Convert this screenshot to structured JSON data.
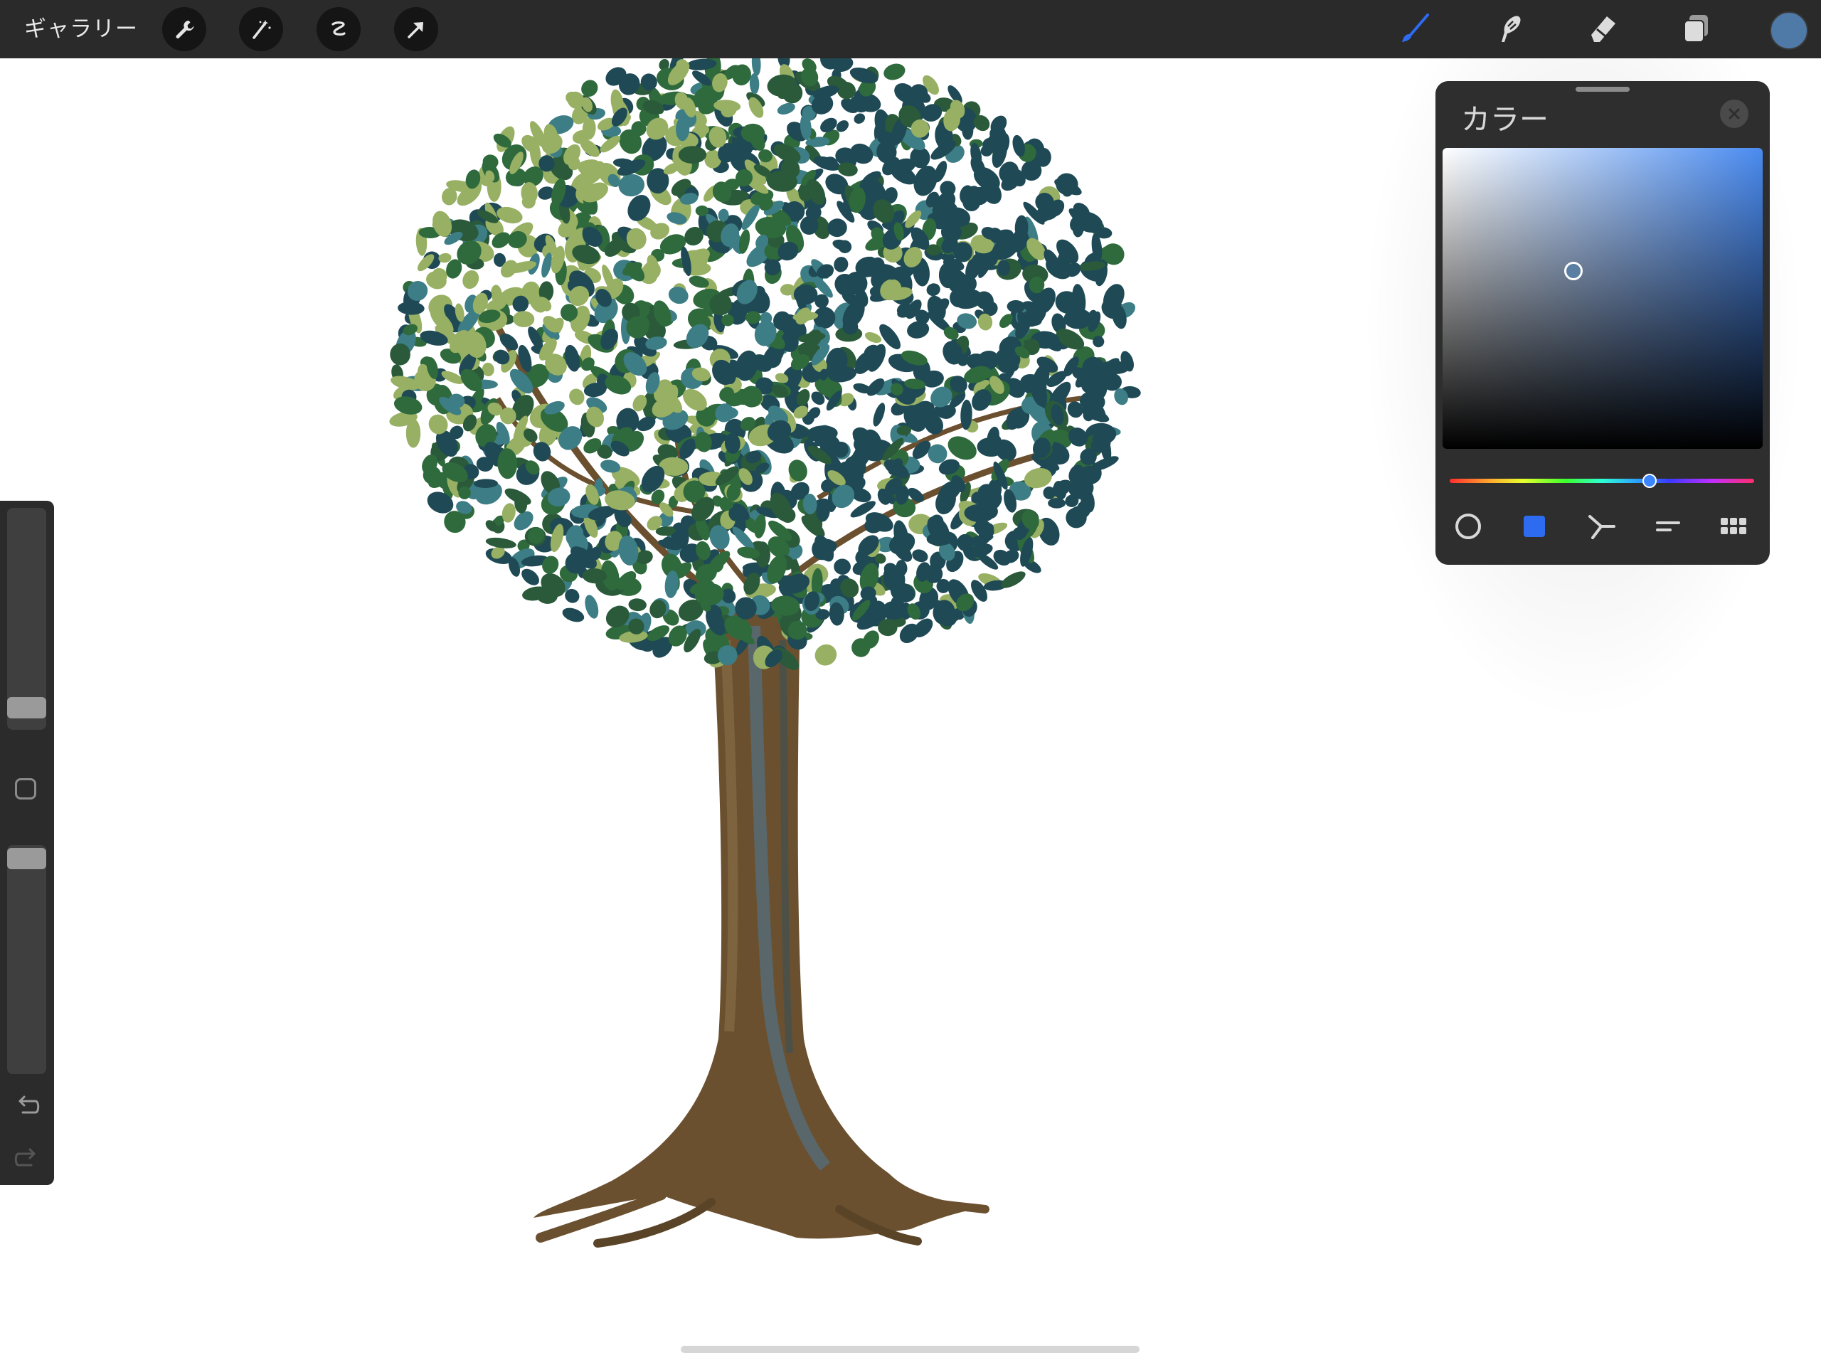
{
  "toolbar": {
    "gallery_label": "ギャラリー",
    "left_tools": [
      {
        "icon": "wrench-icon"
      },
      {
        "icon": "magic-wand-icon"
      },
      {
        "icon": "selection-icon"
      },
      {
        "icon": "transform-arrow-icon"
      }
    ],
    "right_tools": [
      {
        "icon": "brush-icon",
        "active": true
      },
      {
        "icon": "smudge-icon"
      },
      {
        "icon": "eraser-icon"
      },
      {
        "icon": "layers-icon"
      }
    ],
    "current_color": "#4f7aa8",
    "active_color": "#2d6cf0"
  },
  "color_panel": {
    "title": "カラー",
    "hue_color": "#4a8bf0",
    "hue_position": 0.66,
    "saturation": 0.42,
    "brightness": 0.59,
    "modes": [
      {
        "icon": "disc-mode-icon",
        "active": false
      },
      {
        "icon": "classic-mode-icon",
        "active": true
      },
      {
        "icon": "harmony-mode-icon",
        "active": false
      },
      {
        "icon": "value-mode-icon",
        "active": false
      },
      {
        "icon": "palettes-mode-icon",
        "active": false
      }
    ]
  },
  "sidebar": {
    "brush_size_level": 0.1,
    "opacity_level": 0.96
  },
  "canvas": {
    "subject_colors": {
      "foliage_dark": "#1f4a55",
      "foliage_mid": "#2f6a3c",
      "foliage_light": "#98b063",
      "trunk": "#6b5030",
      "trunk_highlight": "#4a7a9c"
    }
  }
}
